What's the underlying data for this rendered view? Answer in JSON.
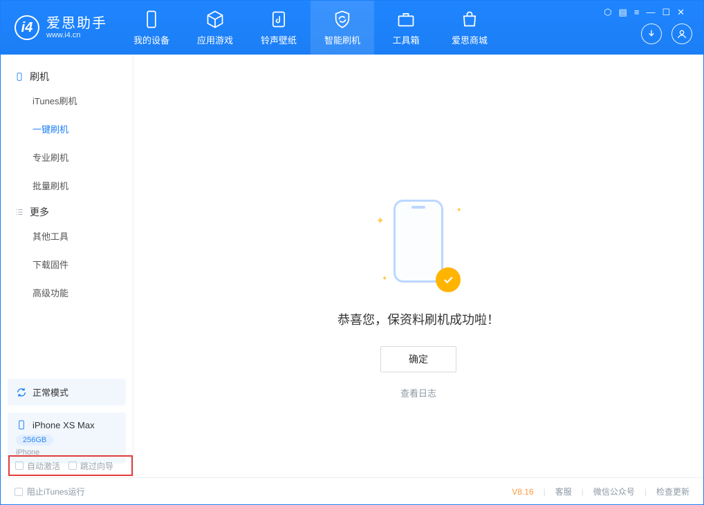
{
  "app": {
    "name": "爱思助手",
    "site": "www.i4.cn"
  },
  "nav": {
    "device": "我的设备",
    "apps": "应用游戏",
    "ringtone": "铃声壁纸",
    "flash": "智能刷机",
    "toolbox": "工具箱",
    "mall": "爱思商城"
  },
  "sidebar": {
    "group_flash": "刷机",
    "items_flash": {
      "itunes": "iTunes刷机",
      "oneclick": "一键刷机",
      "pro": "专业刷机",
      "batch": "批量刷机"
    },
    "group_more": "更多",
    "items_more": {
      "other": "其他工具",
      "firmware": "下载固件",
      "advanced": "高级功能"
    }
  },
  "device_panel": {
    "mode": "正常模式",
    "model": "iPhone XS Max",
    "capacity": "256GB",
    "brand": "iPhone"
  },
  "checkboxes": {
    "auto_activate": "自动激活",
    "skip_guide": "跳过向导"
  },
  "success": {
    "message": "恭喜您，保资料刷机成功啦！",
    "ok": "确定",
    "log": "查看日志"
  },
  "status": {
    "block_itunes": "阻止iTunes运行",
    "version": "V8.16",
    "support": "客服",
    "wechat": "微信公众号",
    "update": "检查更新"
  }
}
